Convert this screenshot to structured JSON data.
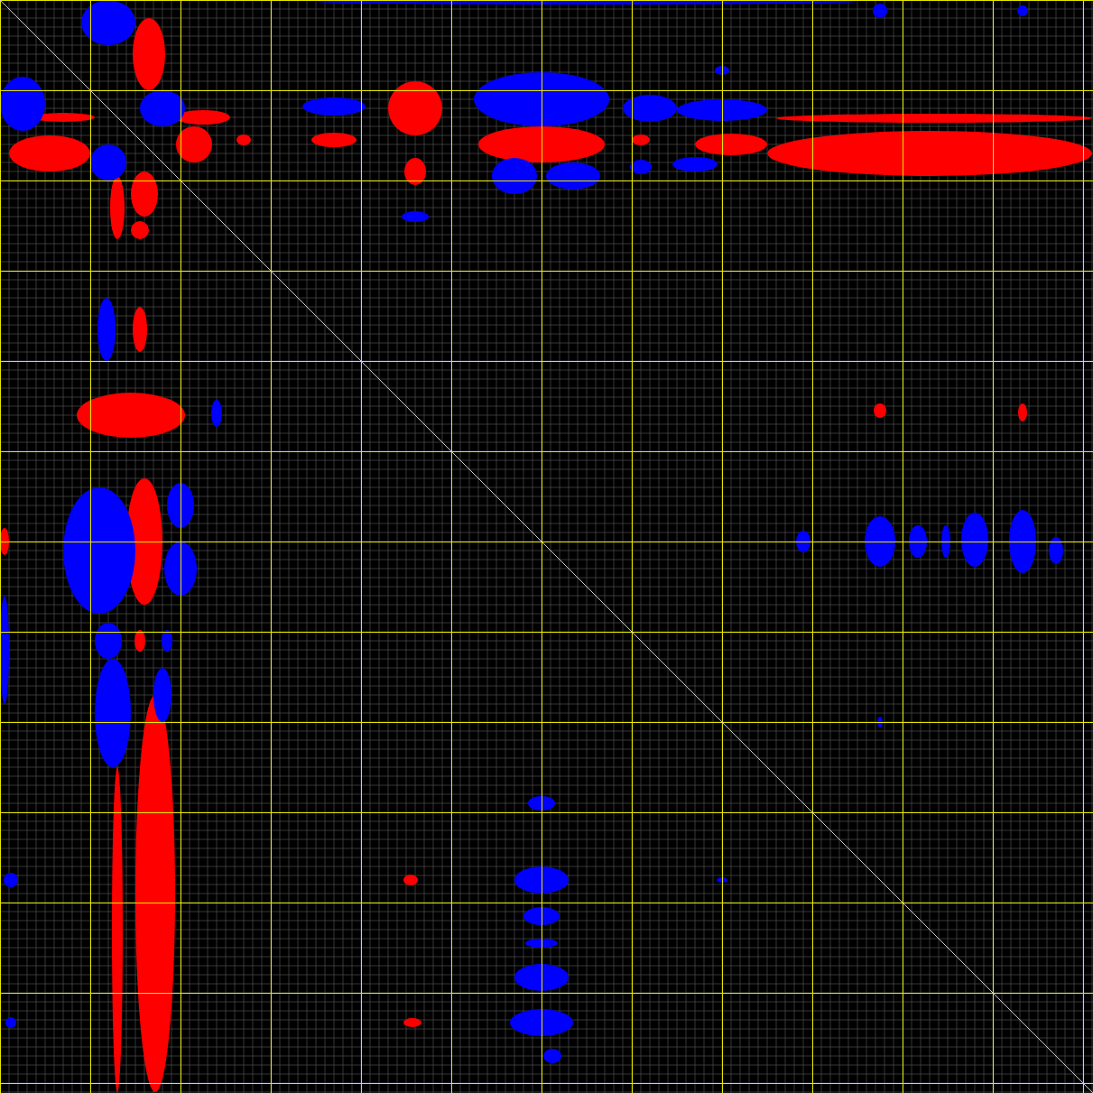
{
  "contour_plot": {
    "contour_levels": [
      {
        "kind": "positive",
        "color": "#ff0000"
      },
      {
        "kind": "negative",
        "color": "#0000ff"
      }
    ]
  }
}
